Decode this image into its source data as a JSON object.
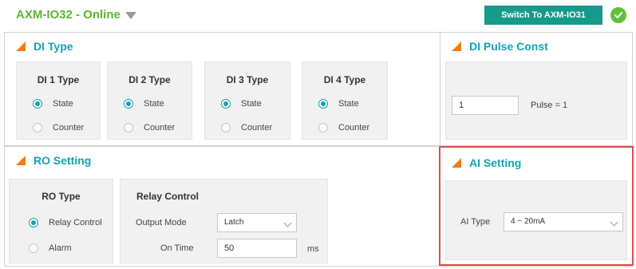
{
  "header": {
    "device_title": "AXM-IO32 - Online",
    "switch_label": "Switch To AXM-IO31"
  },
  "di_type": {
    "title": "DI Type",
    "channels": [
      {
        "label": "DI 1 Type",
        "options": [
          "State",
          "Counter"
        ],
        "selected": "State"
      },
      {
        "label": "DI 2 Type",
        "options": [
          "State",
          "Counter"
        ],
        "selected": "State"
      },
      {
        "label": "DI 3 Type",
        "options": [
          "State",
          "Counter"
        ],
        "selected": "State"
      },
      {
        "label": "DI 4 Type",
        "options": [
          "State",
          "Counter"
        ],
        "selected": "State"
      }
    ]
  },
  "di_pulse": {
    "title": "DI Pulse Const",
    "value": "1",
    "caption": "Pulse = 1"
  },
  "ro_setting": {
    "title": "RO Setting",
    "ro_type": {
      "label": "RO Type",
      "options": [
        "Relay Control",
        "Alarm"
      ],
      "selected": "Relay Control"
    },
    "relay_control": {
      "label": "Relay Control",
      "output_mode_label": "Output Mode",
      "output_mode_value": "Latch",
      "on_time_label": "On Time",
      "on_time_value": "50",
      "on_time_unit": "ms"
    }
  },
  "ai_setting": {
    "title": "AI Setting",
    "ai_type_label": "AI Type",
    "ai_type_value": "4 ~ 20mA"
  },
  "colors": {
    "accent": "#12a3b3",
    "brand_green": "#5bb531",
    "button": "#159a8c",
    "title_triangle": "#f07c12",
    "highlight": "#e04b4b"
  }
}
